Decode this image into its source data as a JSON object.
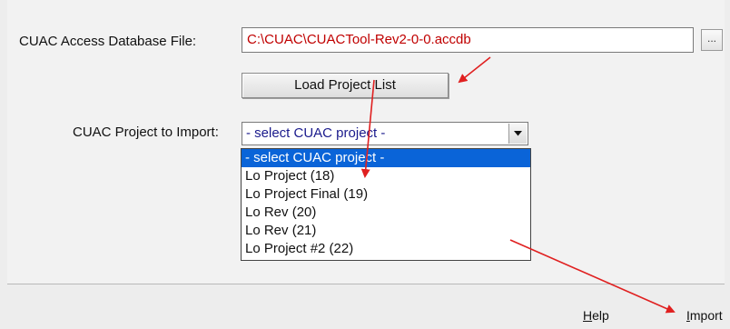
{
  "form": {
    "db_label": "CUAC Access Database File:",
    "db_path": "C:\\CUAC\\CUACTool-Rev2-0-0.accdb",
    "browse_label": "...",
    "load_button": "Load Project List",
    "project_label": "CUAC Project to Import:",
    "project_selected": "- select CUAC project -",
    "project_options": [
      "- select CUAC project -",
      "Lo Project (18)",
      "Lo Project Final (19)",
      "Lo Rev (20)",
      "Lo Rev (21)",
      "Lo Project #2 (22)"
    ]
  },
  "footer": {
    "help": {
      "mnemonic": "H",
      "rest": "elp"
    },
    "import": {
      "mnemonic": "I",
      "rest": "mport"
    }
  },
  "colors": {
    "path_text": "#c00000",
    "selection": "#0a64d8",
    "annotation_arrows": "#e02020"
  }
}
